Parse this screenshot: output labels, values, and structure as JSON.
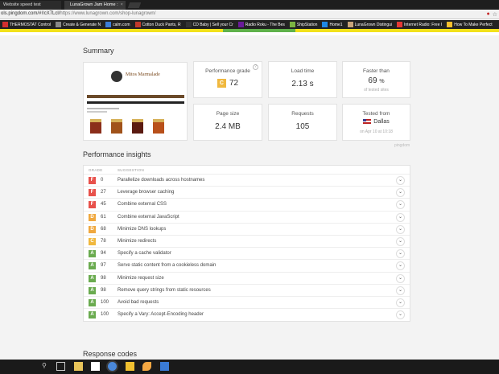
{
  "browser": {
    "tabs": [
      {
        "label": "Website speed test"
      },
      {
        "label": "LunaGrown Jam Home :"
      }
    ],
    "url": {
      "prefix": "ols.pingdom.com/#!/cX7Lcl/",
      "rest": "https://www.lunagrown.com/shop-lunagrown/"
    },
    "bookmarks": [
      {
        "label": "THERMOSTAT Control",
        "icon": "red-h-icon",
        "color": "#d32f2f"
      },
      {
        "label": "Create & Generate N",
        "icon": "bookmark-icon",
        "color": "#888888"
      },
      {
        "label": "calm.com",
        "icon": "calm-icon",
        "color": "#3b7dd8"
      },
      {
        "label": "Cotton Duck Pants, R",
        "icon": "bookmark-icon",
        "color": "#c0392b"
      },
      {
        "label": "CD Baby | Sell your Cr",
        "icon": "bookmark-icon",
        "color": "#333333"
      },
      {
        "label": "Radio Roku - The Bes",
        "icon": "bookmark-icon",
        "color": "#6a1b9a"
      },
      {
        "label": "ShipStation",
        "icon": "shipstation-icon",
        "color": "#7cb342"
      },
      {
        "label": "Home1",
        "icon": "bookmark-icon",
        "color": "#1e88e5"
      },
      {
        "label": "LunaGrown Distingui",
        "icon": "bookmark-icon",
        "color": "#c8a47a"
      },
      {
        "label": "Internet Radio: Free I",
        "icon": "radio-icon",
        "color": "#e53935"
      },
      {
        "label": "How To Make Perfect",
        "icon": "bookmark-icon",
        "color": "#fbc02d"
      }
    ]
  },
  "summary": {
    "title": "Summary",
    "cards": {
      "grade": {
        "label": "Performance grade",
        "letter": "C",
        "value": "72"
      },
      "load": {
        "label": "Load time",
        "value": "2.13 s"
      },
      "faster": {
        "label": "Faster than",
        "value": "69",
        "unit": "%",
        "sub": "of tested sites"
      },
      "size": {
        "label": "Page size",
        "value": "2.4 MB"
      },
      "requests": {
        "label": "Requests",
        "value": "105"
      },
      "tested": {
        "label": "Tested from",
        "value": "Dallas",
        "sub": "on Apr 10 at 10:18"
      }
    },
    "thumbnail_title": "Mitos Marmalade"
  },
  "brand": "pingdom",
  "insights": {
    "title": "Performance insights",
    "col_grade": "GRADE",
    "col_suggestion": "SUGGESTION",
    "rows": [
      {
        "grade": "F",
        "score": "0",
        "text": "Parallelize downloads across hostnames",
        "color": "#e8514b"
      },
      {
        "grade": "F",
        "score": "27",
        "text": "Leverage browser caching",
        "color": "#e8514b"
      },
      {
        "grade": "F",
        "score": "45",
        "text": "Combine external CSS",
        "color": "#e8514b"
      },
      {
        "grade": "D",
        "score": "61",
        "text": "Combine external JavaScript",
        "color": "#f0a83e"
      },
      {
        "grade": "D",
        "score": "68",
        "text": "Minimize DNS lookups",
        "color": "#f0a83e"
      },
      {
        "grade": "C",
        "score": "78",
        "text": "Minimize redirects",
        "color": "#f0b83e"
      },
      {
        "grade": "A",
        "score": "94",
        "text": "Specify a cache validator",
        "color": "#6aab4f"
      },
      {
        "grade": "A",
        "score": "97",
        "text": "Serve static content from a cookieless domain",
        "color": "#6aab4f"
      },
      {
        "grade": "A",
        "score": "98",
        "text": "Minimize request size",
        "color": "#6aab4f"
      },
      {
        "grade": "A",
        "score": "98",
        "text": "Remove query strings from static resources",
        "color": "#6aab4f"
      },
      {
        "grade": "A",
        "score": "100",
        "text": "Avoid bad requests",
        "color": "#6aab4f"
      },
      {
        "grade": "A",
        "score": "100",
        "text": "Specify a Vary: Accept-Encoding header",
        "color": "#6aab4f"
      }
    ]
  },
  "response": {
    "title": "Response codes"
  }
}
